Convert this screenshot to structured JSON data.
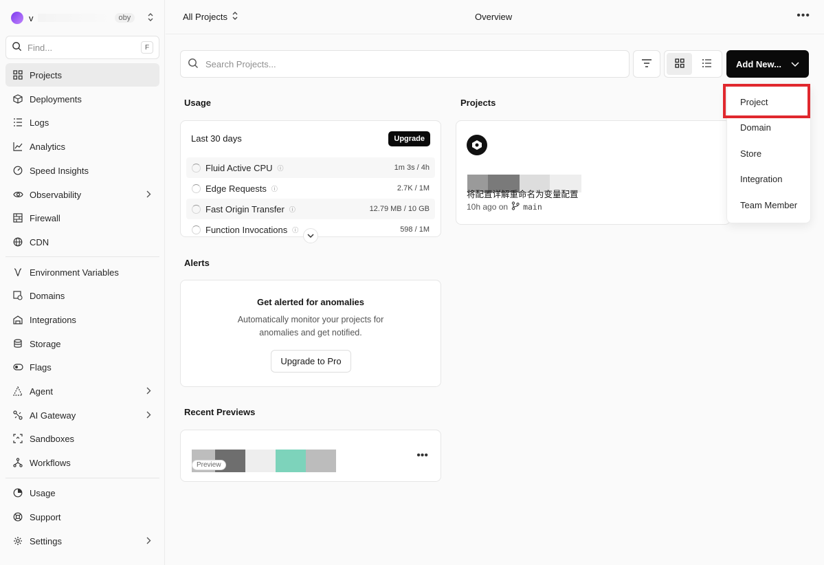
{
  "team": {
    "initial": "v",
    "plan": "oby"
  },
  "find": {
    "placeholder": "Find...",
    "shortcut": "F"
  },
  "sidebar": {
    "items": [
      {
        "label": "Projects",
        "icon": "grid-icon",
        "active": true
      },
      {
        "label": "Deployments",
        "icon": "cube-icon"
      },
      {
        "label": "Logs",
        "icon": "list-icon"
      },
      {
        "label": "Analytics",
        "icon": "line-chart-icon"
      },
      {
        "label": "Speed Insights",
        "icon": "gauge-icon"
      },
      {
        "label": "Observability",
        "icon": "eye-icon",
        "chevron": true
      },
      {
        "label": "Firewall",
        "icon": "firewall-icon"
      },
      {
        "label": "CDN",
        "icon": "globe-icon"
      },
      {
        "label": "Environment Variables",
        "icon": "variable-icon"
      },
      {
        "label": "Domains",
        "icon": "domain-icon"
      },
      {
        "label": "Integrations",
        "icon": "integrations-icon"
      },
      {
        "label": "Storage",
        "icon": "database-icon"
      },
      {
        "label": "Flags",
        "icon": "toggle-icon"
      },
      {
        "label": "Agent",
        "icon": "agent-icon",
        "chevron": true
      },
      {
        "label": "AI Gateway",
        "icon": "gateway-icon",
        "chevron": true
      },
      {
        "label": "Sandboxes",
        "icon": "sandbox-icon"
      },
      {
        "label": "Workflows",
        "icon": "workflow-icon"
      },
      {
        "label": "Usage",
        "icon": "usage-icon"
      },
      {
        "label": "Support",
        "icon": "support-icon"
      },
      {
        "label": "Settings",
        "icon": "gear-icon",
        "chevron": true
      }
    ]
  },
  "topbar": {
    "scope": "All Projects",
    "title": "Overview"
  },
  "toolbar": {
    "search_placeholder": "Search Projects...",
    "add_new_label": "Add New..."
  },
  "usage": {
    "section_title": "Usage",
    "period": "Last 30 days",
    "upgrade_label": "Upgrade",
    "metrics": [
      {
        "name": "Fluid Active CPU",
        "value": "1m 3s / 4h"
      },
      {
        "name": "Edge Requests",
        "value": "2.7K / 1M"
      },
      {
        "name": "Fast Origin Transfer",
        "value": "12.79 MB / 10 GB"
      },
      {
        "name": "Function Invocations",
        "value": "598 / 1M"
      }
    ]
  },
  "alerts": {
    "section_title": "Alerts",
    "title": "Get alerted for anomalies",
    "description": "Automatically monitor your projects for anomalies and get notified.",
    "button_label": "Upgrade to Pro"
  },
  "previews": {
    "section_title": "Recent Previews",
    "pill_label": "Preview"
  },
  "projects": {
    "section_title": "Projects",
    "card": {
      "description": "将配置详解重命名为变量配置",
      "updated": "10h ago on",
      "branch": "main"
    }
  },
  "dropdown": {
    "items": [
      "Project",
      "Domain",
      "Store",
      "Integration",
      "Team Member"
    ],
    "highlighted": "Project"
  },
  "colors": {
    "accent": "#0a0a0a",
    "highlight": "#e0282e",
    "avatar": "#7c3aed"
  }
}
